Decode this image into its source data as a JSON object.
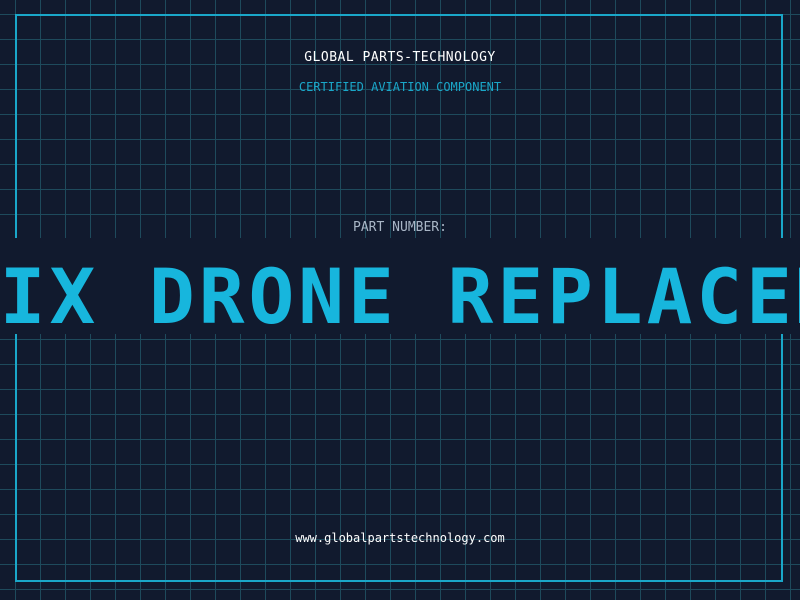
{
  "header": {
    "brand": "GLOBAL PARTS-TECHNOLOGY",
    "tagline": "CERTIFIED AVIATION COMPONENT"
  },
  "part": {
    "label": "PART NUMBER:",
    "value": "NIX DRONE REPLACEME"
  },
  "footer": {
    "url": "www.globalpartstechnology.com"
  },
  "colors": {
    "background": "#111a2e",
    "grid": "#1e4a5c",
    "accent": "#1aa7c9",
    "part_text": "#17b6dd",
    "label": "#a9b6c6",
    "text": "#ffffff"
  }
}
